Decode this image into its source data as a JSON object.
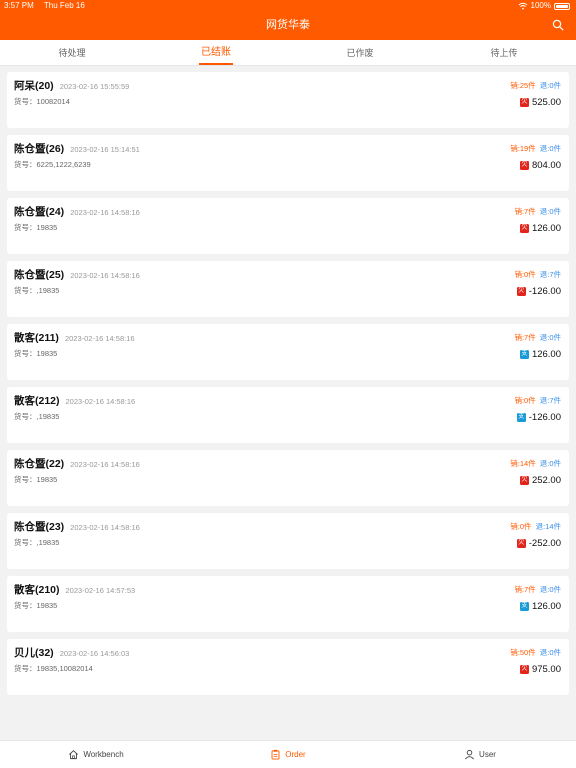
{
  "status_bar": {
    "time": "3:57 PM",
    "date": "Thu Feb 16",
    "battery": "100%"
  },
  "header": {
    "title": "网货华泰",
    "search_icon": "search-icon"
  },
  "tabs": [
    {
      "label": "待处理",
      "active": false
    },
    {
      "label": "已结账",
      "active": true
    },
    {
      "label": "已作废",
      "active": false
    },
    {
      "label": "待上传",
      "active": false
    }
  ],
  "orders": [
    {
      "name": "阿呆(20)",
      "time": "2023-02-16 15:55:59",
      "code": "货号：10082014",
      "sold": "销:25件",
      "returned": "退:0件",
      "pay": "red",
      "pay_glyph": "欠",
      "amount": "525.00"
    },
    {
      "name": "陈仓暨(26)",
      "time": "2023-02-16 15:14:51",
      "code": "货号：6225,1222,6239",
      "sold": "销:19件",
      "returned": "退:0件",
      "pay": "red",
      "pay_glyph": "欠",
      "amount": "804.00"
    },
    {
      "name": "陈仓暨(24)",
      "time": "2023-02-16 14:58:16",
      "code": "货号：19835",
      "sold": "销:7件",
      "returned": "退:0件",
      "pay": "red",
      "pay_glyph": "欠",
      "amount": "126.00"
    },
    {
      "name": "陈仓暨(25)",
      "time": "2023-02-16 14:58:16",
      "code": "货号：,19835",
      "sold": "销:0件",
      "returned": "退:7件",
      "pay": "red",
      "pay_glyph": "欠",
      "amount": "-126.00"
    },
    {
      "name": "散客(211)",
      "time": "2023-02-16 14:58:16",
      "code": "货号：19835",
      "sold": "销:7件",
      "returned": "退:0件",
      "pay": "blue",
      "pay_glyph": "支",
      "amount": "126.00"
    },
    {
      "name": "散客(212)",
      "time": "2023-02-16 14:58:16",
      "code": "货号：,19835",
      "sold": "销:0件",
      "returned": "退:7件",
      "pay": "blue",
      "pay_glyph": "支",
      "amount": "-126.00"
    },
    {
      "name": "陈仓暨(22)",
      "time": "2023-02-16 14:58:16",
      "code": "货号：19835",
      "sold": "销:14件",
      "returned": "退:0件",
      "pay": "red",
      "pay_glyph": "欠",
      "amount": "252.00"
    },
    {
      "name": "陈仓暨(23)",
      "time": "2023-02-16 14:58:16",
      "code": "货号：,19835",
      "sold": "销:0件",
      "returned": "退:14件",
      "pay": "red",
      "pay_glyph": "欠",
      "amount": "-252.00"
    },
    {
      "name": "散客(210)",
      "time": "2023-02-16 14:57:53",
      "code": "货号：19835",
      "sold": "销:7件",
      "returned": "退:0件",
      "pay": "blue",
      "pay_glyph": "支",
      "amount": "126.00"
    },
    {
      "name": "贝儿(32)",
      "time": "2023-02-16 14:56:03",
      "code": "货号：19835,10082014",
      "sold": "销:50件",
      "returned": "退:0件",
      "pay": "red",
      "pay_glyph": "欠",
      "amount": "975.00"
    }
  ],
  "bottom_nav": [
    {
      "label": "Workbench",
      "icon": "home-icon",
      "active": false
    },
    {
      "label": "Order",
      "icon": "clipboard-icon",
      "active": true
    },
    {
      "label": "User",
      "icon": "user-icon",
      "active": false
    }
  ],
  "colors": {
    "brand": "#ff5a00",
    "sold": "#ff5a00",
    "returned": "#3a8ee6",
    "pay_red": "#e1251b",
    "pay_blue": "#1a9bd7"
  }
}
